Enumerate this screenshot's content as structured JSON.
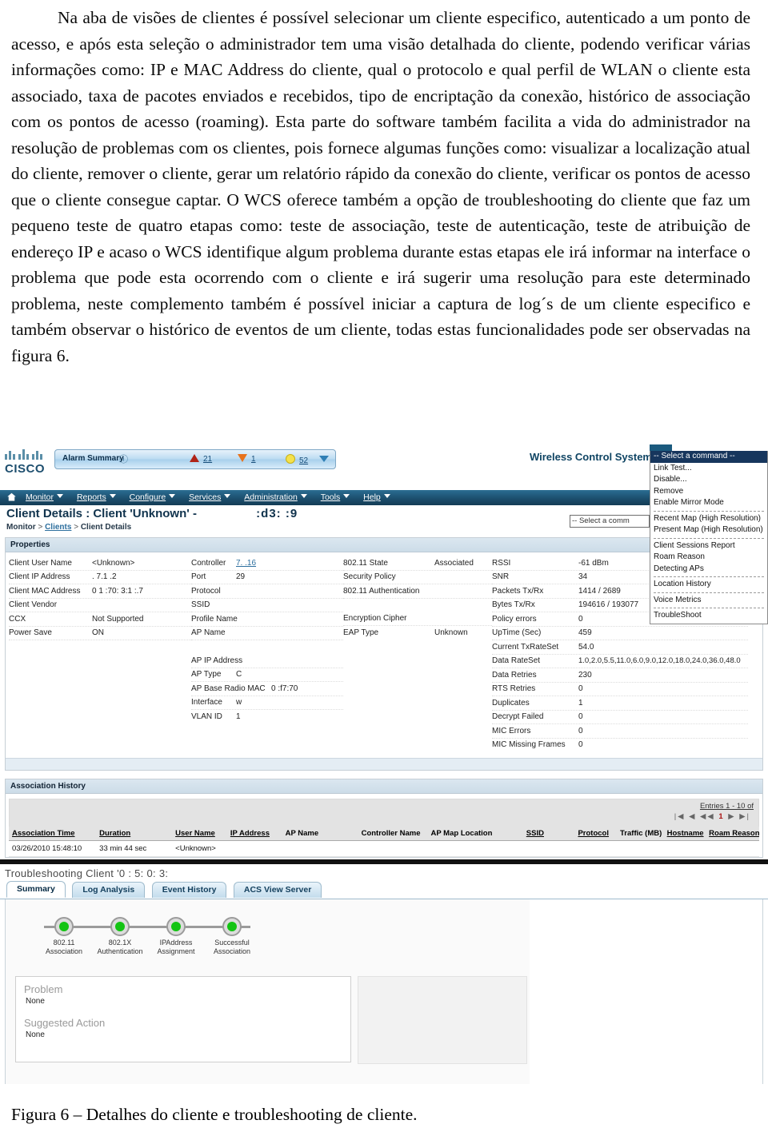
{
  "document": {
    "paragraph": "Na aba de visões de clientes é possível selecionar um cliente especifico, autenticado a um ponto de acesso, e após esta seleção o administrador tem uma visão detalhada do cliente, podendo verificar várias informações como: IP e MAC Address do cliente, qual o protocolo e qual perfil de WLAN o cliente esta associado, taxa de pacotes enviados e recebidos, tipo de encriptação da conexão, histórico de associação com os pontos de acesso (roaming). Esta parte do software também facilita a vida do administrador na resolução de problemas com os clientes, pois fornece algumas funções como: visualizar a localização atual do cliente, remover o cliente, gerar um relatório rápido da conexão do cliente, verificar os pontos de acesso que o cliente consegue captar. O WCS oferece também a opção de troubleshooting do cliente que faz um pequeno teste de quatro etapas como: teste de associação, teste de autenticação, teste de atribuição de endereço IP e acaso o WCS identifique algum problema durante estas etapas ele irá informar na interface o problema que pode esta ocorrendo com o cliente e irá sugerir uma resolução para este determinado problema, neste complemento também é possível iniciar a captura de log´s de um cliente especifico e também observar o histórico de eventos de um cliente, todas estas funcionalidades pode ser observadas na figura 6.",
    "figure_caption": "Figura 6 – Detalhes do cliente e troubleshooting de cliente."
  },
  "app": {
    "brand": "CISCO",
    "product_title": "Wireless Control System",
    "alarm_summary": {
      "label": "Alarm Summary",
      "critical": "21",
      "major": "1",
      "minor": "52"
    },
    "nav": [
      {
        "label": "Monitor",
        "accel": "M"
      },
      {
        "label": "Reports",
        "accel": "R"
      },
      {
        "label": "Configure",
        "accel": "C"
      },
      {
        "label": "Services",
        "accel": "S"
      },
      {
        "label": "Administration",
        "accel": "A"
      },
      {
        "label": "Tools",
        "accel": "T"
      },
      {
        "label": "Help",
        "accel": "H"
      }
    ],
    "page_title": "Client Details : Client 'Unknown' -",
    "page_title_mac": ":d3:   :9",
    "breadcrumb": {
      "root": "Monitor",
      "sep1": ">",
      "middle": "Clients",
      "sep2": ">",
      "current": "Client Details"
    },
    "command_select_value": "-- Select a comm",
    "command_menu": {
      "selected": "-- Select a command --",
      "groups": [
        [
          "Link Test...",
          "Disable...",
          "Remove",
          "Enable Mirror Mode"
        ],
        [
          "Recent Map (High Resolution)",
          "Present Map (High Resolution)"
        ],
        [
          "Client Sessions Report",
          "Roam Reason",
          "Detecting APs"
        ],
        [
          "Location History"
        ],
        [
          "Voice Metrics"
        ],
        [
          "TroubleShoot"
        ]
      ]
    }
  },
  "properties": {
    "header": "Properties",
    "col1": [
      {
        "key": "Client User Name",
        "value": "<Unknown>"
      },
      {
        "key": "Client IP Address",
        "value": ". 7.1 .2"
      },
      {
        "key": "Client MAC Address",
        "value": "0  1 :70:  3:1 :.7"
      },
      {
        "key": "Client Vendor",
        "value": ""
      },
      {
        "key": "CCX",
        "value": "Not Supported"
      },
      {
        "key": "Power Save",
        "value": "ON"
      }
    ],
    "col2": [
      {
        "key": "Controller",
        "value": "7. .16",
        "link": true
      },
      {
        "key": "Port",
        "value": "29"
      },
      {
        "key": "Protocol",
        "value": ""
      },
      {
        "key": "SSID",
        "value": ""
      },
      {
        "key": "Profile Name",
        "value": ""
      },
      {
        "key": "AP Name",
        "value": ""
      },
      {
        "key": "AP IP Address",
        "value": ""
      },
      {
        "key": "AP Type",
        "value": "C"
      },
      {
        "key": "AP Base Radio MAC",
        "value": "0        :f7:70"
      },
      {
        "key": "Interface",
        "value": "w"
      },
      {
        "key": "VLAN ID",
        "value": "1"
      }
    ],
    "col3": [
      {
        "key": "802.11 State",
        "value": "Associated"
      },
      {
        "key": "Security Policy",
        "value": ""
      },
      {
        "key": "802.11 Authentication",
        "value": ""
      },
      {
        "key": "Encryption Cipher",
        "value": ""
      },
      {
        "key": "EAP Type",
        "value": "Unknown"
      }
    ],
    "col4": [
      {
        "key": "RSSI",
        "value": "-61 dBm"
      },
      {
        "key": "SNR",
        "value": "34"
      },
      {
        "key": "Packets Tx/Rx",
        "value": "1414 / 2689"
      },
      {
        "key": "Bytes Tx/Rx",
        "value": "194616 / 193077"
      },
      {
        "key": "Policy errors",
        "value": "0"
      },
      {
        "key": "UpTime (Sec)",
        "value": "459"
      },
      {
        "key": "Current TxRateSet",
        "value": "54.0"
      },
      {
        "key": "Data RateSet",
        "value": "1.0,2.0,5.5,11.0,6.0,9.0,12.0,18.0,24.0,36.0,48.0"
      },
      {
        "key": "Data Retries",
        "value": "230"
      },
      {
        "key": "RTS Retries",
        "value": "0"
      },
      {
        "key": "Duplicates",
        "value": "1"
      },
      {
        "key": "Decrypt Failed",
        "value": "0"
      },
      {
        "key": "MIC Errors",
        "value": "0"
      },
      {
        "key": "MIC Missing Frames",
        "value": "0"
      }
    ]
  },
  "association_history": {
    "header": "Association History",
    "entries_label": "Entries 1 - 10 of",
    "pager": "|◀ ◀ ◀◀",
    "page_current": "1",
    "pager_next": "▶ ▶|",
    "columns": [
      "Association Time",
      "Duration",
      "User Name",
      "IP Address",
      "AP Name",
      "Controller Name",
      "AP Map Location",
      "SSID",
      "Protocol",
      "Traffic (MB)",
      "Hostname",
      "Roam Reason"
    ],
    "rows": [
      {
        "association_time": "03/26/2010 15:48:10",
        "duration": "33 min 44 sec",
        "user_name": "<Unknown>",
        "ip_address": "",
        "ap_name": "",
        "controller_name": "",
        "ap_map_location": "",
        "ssid": "",
        "protocol": "",
        "traffic": "",
        "hostname": "",
        "roam_reason": ""
      }
    ]
  },
  "troubleshooting": {
    "title": "Troubleshooting Client '0  :  5:  0:  3:",
    "tabs": [
      {
        "label": "Summary",
        "active": true
      },
      {
        "label": "Log Analysis",
        "active": false
      },
      {
        "label": "Event History",
        "active": false
      },
      {
        "label": "ACS View Server",
        "active": false
      }
    ],
    "steps": [
      {
        "line1": "802.11",
        "line2": "Association",
        "status": "ok"
      },
      {
        "line1": "802.1X",
        "line2": "Authentication",
        "status": "ok"
      },
      {
        "line1": "IPAddress",
        "line2": "Assignment",
        "status": "ok"
      },
      {
        "line1": "Successful",
        "line2": "Association",
        "status": "ok"
      }
    ],
    "problem_heading": "Problem",
    "problem_value": "None",
    "suggested_heading": "Suggested Action",
    "suggested_value": "None"
  },
  "colors": {
    "nav_bar": "#1c4f6e",
    "panel_head": "#dbe7f0",
    "link": "#2d6f9e",
    "ok_green": "#13c413",
    "critical_red": "#b02418",
    "major_orange": "#e8721c",
    "minor_yellow": "#f4e14c",
    "menu_selected": "#17365d"
  }
}
